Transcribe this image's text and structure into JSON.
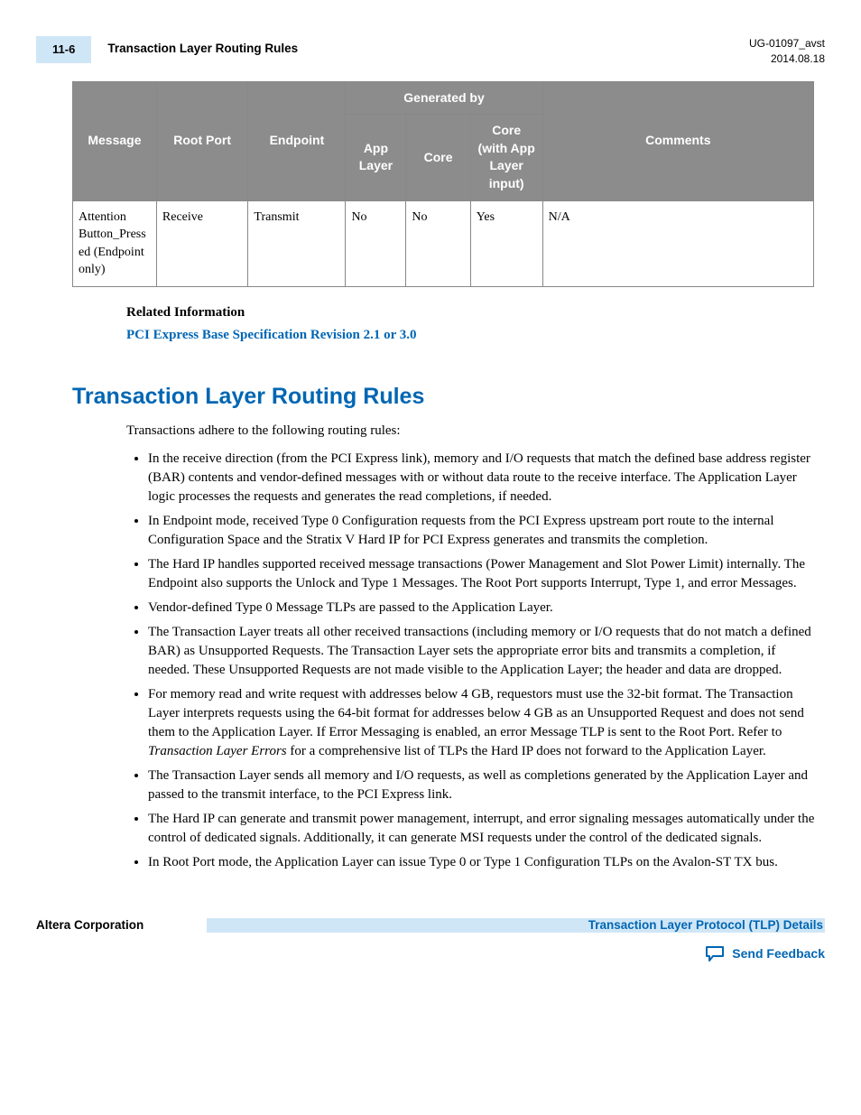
{
  "header": {
    "page_num": "11-6",
    "running_title": "Transaction Layer Routing Rules",
    "doc_id": "UG-01097_avst",
    "date": "2014.08.18"
  },
  "table": {
    "head": {
      "message": "Message",
      "root_port": "Root Port",
      "endpoint": "Endpoint",
      "generated_by": "Generated by",
      "app_layer": "App Layer",
      "core": "Core",
      "core_app": "Core (with App Layer input)",
      "comments": "Comments"
    },
    "row": {
      "message": "Attention Button_Pressed (Endpoint only)",
      "root_port": "Receive",
      "endpoint": "Transmit",
      "app_layer": "No",
      "core": "No",
      "core_app": "Yes",
      "comments": "N/A"
    }
  },
  "related": {
    "heading": "Related Information",
    "link": "PCI Express Base Specification Revision 2.1 or 3.0"
  },
  "section": {
    "title": "Transaction Layer Routing Rules",
    "intro": "Transactions adhere to the following routing rules:",
    "b1": "In the receive direction (from the PCI Express link), memory and I/O requests that match the defined base address register (BAR) contents and vendor-defined messages with or without data route to the receive interface. The Application Layer logic processes the requests and generates the read completions, if needed.",
    "b2": "In Endpoint mode, received Type 0 Configuration requests from the PCI Express upstream port route to the internal Configuration Space and the Stratix V Hard IP for PCI Express generates and transmits the completion.",
    "b3": "The Hard IP handles supported received message transactions (Power Management and Slot Power Limit) internally. The Endpoint also supports the Unlock and Type 1 Messages. The Root Port supports Interrupt, Type 1, and error Messages.",
    "b4": "Vendor‑defined Type 0 Message TLPs are passed to the Application Layer.",
    "b5": "The Transaction Layer treats all other received transactions (including memory or I/O requests that do not match a defined BAR) as Unsupported Requests. The Transaction Layer sets the appropriate error bits and transmits a completion, if needed. These Unsupported Requests are not made visible to the Application Layer; the header and data are dropped.",
    "b6a": "For memory read and write request with addresses below 4 GB, requestors must use the 32-bit format. The Transaction Layer interprets requests using the 64‑bit format for addresses below 4 GB as an Unsupported Request and does not send them to the Application Layer. If Error Messaging is enabled, an error Message TLP is sent to the Root Port. Refer to ",
    "b6_i": "Transaction Layer Errors",
    "b6b": " for a comprehensive list of TLPs the Hard IP does not forward to the Application Layer.",
    "b7": "The Transaction Layer sends all memory and I/O requests, as well as completions generated by the Application Layer and passed to the transmit interface, to the PCI Express link.",
    "b8": "The Hard IP can generate and transmit power management, interrupt, and error signaling messages automatically under the control of dedicated signals. Additionally, it can generate MSI requests under the control of the dedicated signals.",
    "b9": "In Root Port mode, the Application Layer can issue Type 0 or Type 1 Configuration TLPs on the Avalon-ST TX bus."
  },
  "footer": {
    "left": "Altera Corporation",
    "right": "Transaction Layer Protocol (TLP) Details",
    "feedback": "Send Feedback"
  }
}
